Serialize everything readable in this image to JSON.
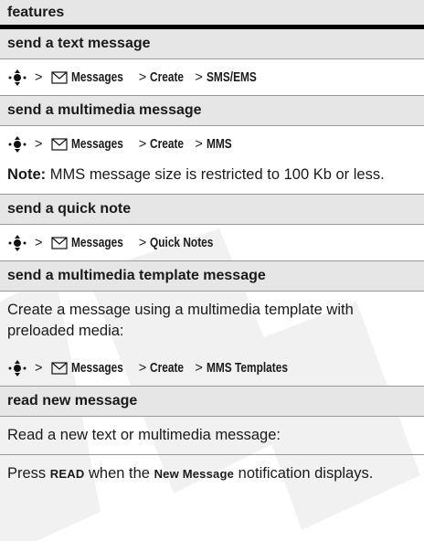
{
  "header": {
    "title": "features"
  },
  "sections": {
    "text_message": {
      "title": "send a text message",
      "path": [
        "Messages",
        "Create",
        "SMS/EMS"
      ]
    },
    "multimedia_message": {
      "title": "send a multimedia message",
      "path": [
        "Messages",
        "Create",
        "MMS"
      ],
      "note_label": "Note:",
      "note_text": "MMS message size is restricted to 100 Kb or less."
    },
    "quick_note": {
      "title": "send a quick note",
      "path": [
        "Messages",
        "Quick Notes"
      ]
    },
    "template_message": {
      "title": "send a multimedia template message",
      "description": "Create a message using a multimedia template with preloaded media:",
      "path": [
        "Messages",
        "Create",
        "MMS Templates"
      ]
    },
    "read_message": {
      "title": "read new message",
      "description": "Read a new text or multimedia message:",
      "press": "Press",
      "key": "READ",
      "when": "when the",
      "notification": "New Message",
      "notification_tail": "notification displays."
    }
  },
  "separator": ">",
  "icons": {
    "nav": "nav-key-icon",
    "messages": "envelope-icon"
  },
  "watermark_color": "#e0e0e0"
}
